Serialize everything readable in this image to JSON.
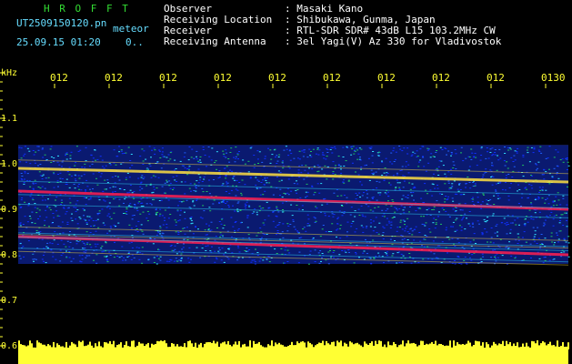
{
  "header": {
    "program_name": "H R O F F T",
    "file_name": "UT2509150120.pn",
    "event_tag": "meteor",
    "datetime": "25.09.15 01:20",
    "level": "0..",
    "info_labels": [
      "Observer",
      "Receiving Location",
      "Receiver",
      "Receiving Antenna"
    ],
    "info_values": [
      ": Masaki Kano",
      ": Shibukawa, Gunma, Japan",
      ": RTL-SDR SDR# 43dB L15 103.2MHz CW",
      ": 3el Yagi(V) Az 330 for Vladivostok"
    ]
  },
  "colors": {
    "background": "#000000",
    "title_green": "#33dd33",
    "label_cyan": "#66ddff",
    "value_white": "#ffffff",
    "axis_yellow": "#ffff33",
    "noise_blue": "#1030ff",
    "trace_red": "#ff2050",
    "trace_yellow": "#ffe040",
    "trace_cyan": "#30e0ff"
  },
  "axes": {
    "y_unit": "kHz",
    "y_ticks": [
      "1.1",
      "1.0",
      "0.9",
      "0.8",
      "0.7",
      "0.6"
    ],
    "x_ticks": [
      "012",
      "012",
      "012",
      "012",
      "012",
      "012",
      "012",
      "012",
      "012",
      "0130"
    ]
  },
  "spectrogram": {
    "type": "heatmap",
    "frequency_range_khz": [
      0.78,
      1.04
    ],
    "x_range_ticks": [
      "012",
      "0130"
    ],
    "traces": [
      {
        "color": "red",
        "start_khz": 0.84,
        "end_khz": 0.8
      },
      {
        "color": "red",
        "start_khz": 0.94,
        "end_khz": 0.9
      },
      {
        "color": "yellow",
        "start_khz": 0.99,
        "end_khz": 0.96
      }
    ]
  },
  "amplitude_strip": {
    "color": "yellow",
    "label": "0.6"
  }
}
